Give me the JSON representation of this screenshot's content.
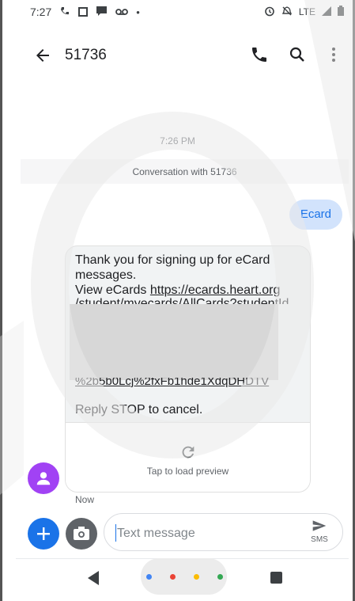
{
  "status_bar": {
    "time": "7:27",
    "network": "LTE",
    "icons": [
      "wifi-calling-icon",
      "image-icon",
      "message-icon",
      "voicemail-icon",
      "dot-icon",
      "alarm-icon",
      "mute-icon",
      "signal-icon",
      "battery-icon"
    ]
  },
  "app_bar": {
    "title": "51736",
    "icons": [
      "back-arrow-icon",
      "phone-icon",
      "search-icon",
      "more-vert-icon"
    ]
  },
  "conversation": {
    "timestamp": "7:26 PM",
    "header": "Conversation with 51736",
    "sent_message": "Ecard",
    "received_message": {
      "line1": "Thank you for signing up for eCard messages.",
      "line2_prefix": "View eCards ",
      "link_visible": "https://ecards.heart.org",
      "link_partial": "/student/myecards/AllCards?studentId",
      "link_tail_partial": "%2b5b0Lcj%2fxFb1hde1XdqDHDTV",
      "reply_text": "Reply STOP to cancel.",
      "preview_label": "Tap to load preview",
      "time": "Now"
    }
  },
  "compose": {
    "placeholder": "Text message",
    "send_label": "SMS"
  },
  "nav": {
    "dots": [
      "#4285f4",
      "#ea4335",
      "#fbbc04",
      "#34a853"
    ]
  },
  "colors": {
    "accent": "#1a73e8",
    "sent_bubble": "#d2e3fc",
    "avatar": "#a142f4"
  }
}
